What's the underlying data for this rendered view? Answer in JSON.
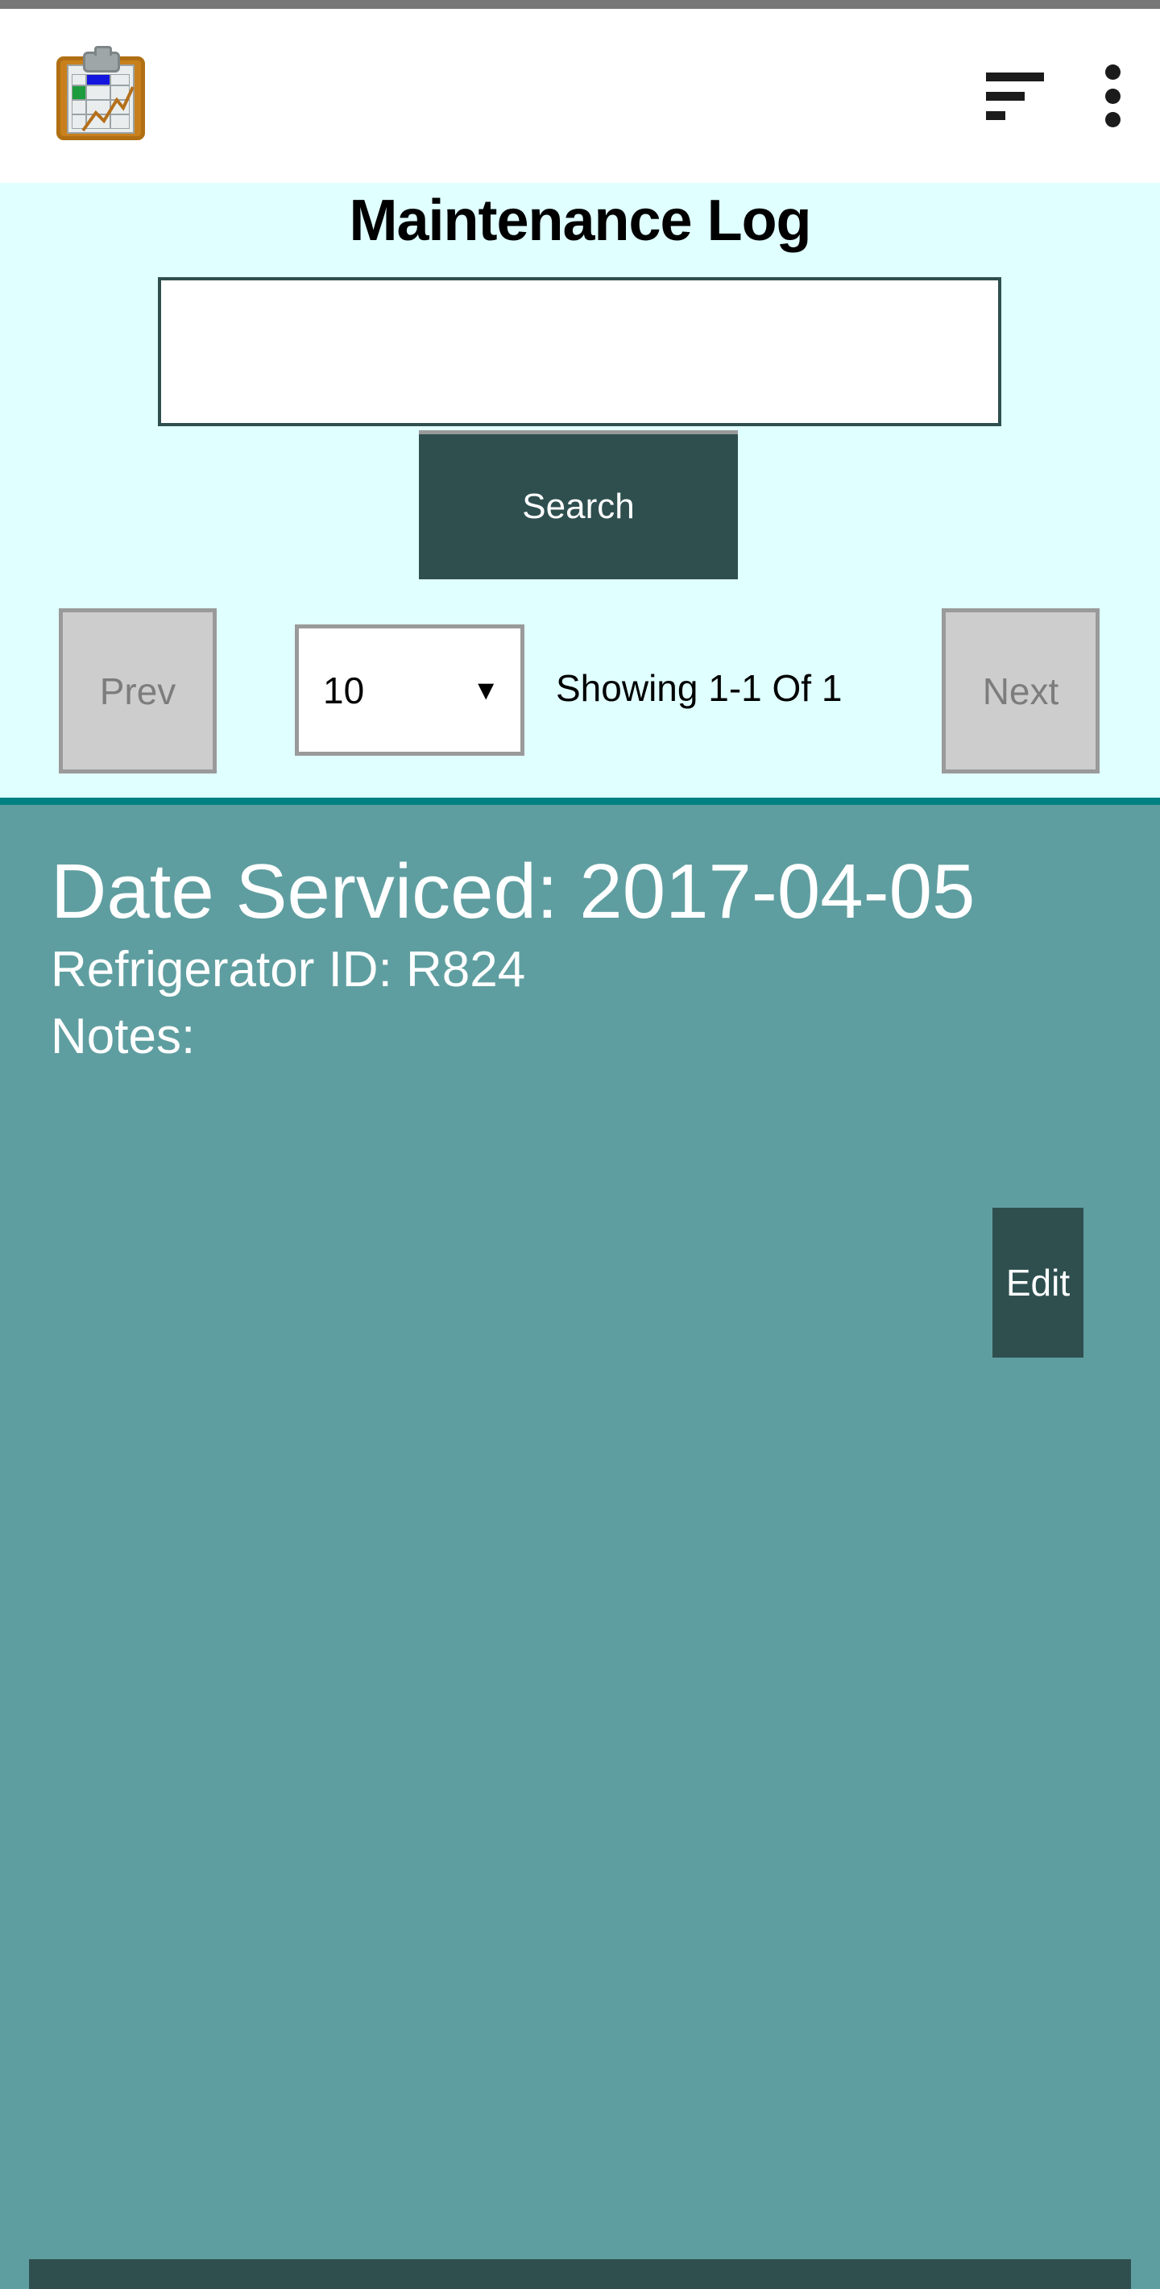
{
  "header": {
    "app_icon": "clipboard-chart-icon",
    "sort_icon": "sort-lines-icon",
    "overflow_icon": "kebab-menu-icon"
  },
  "search": {
    "title": "Maintenance Log",
    "input_value": "",
    "input_placeholder": "",
    "button_label": "Search"
  },
  "pagination": {
    "prev_label": "Prev",
    "next_label": "Next",
    "page_size_value": "10",
    "page_size_arrow": "▼",
    "showing_text": "Showing 1-1 Of 1"
  },
  "record": {
    "date_serviced": "Date Serviced: 2017-04-05",
    "refrigerator_id": "Refrigerator ID: R824",
    "notes": "Notes:",
    "edit_label": "Edit"
  },
  "colors": {
    "status_bar": "#777777",
    "header_background": "#ffffff",
    "panel_background": "#e0ffff",
    "accent_divider": "#008080",
    "card_background": "#5f9ea0",
    "primary_dark": "#2f4f4f",
    "disabled_fill": "#cdcdcd",
    "disabled_border": "#9a9a9a",
    "disabled_text": "#7d7d7d",
    "text_light": "#ffffff",
    "text_dark": "#000000"
  }
}
